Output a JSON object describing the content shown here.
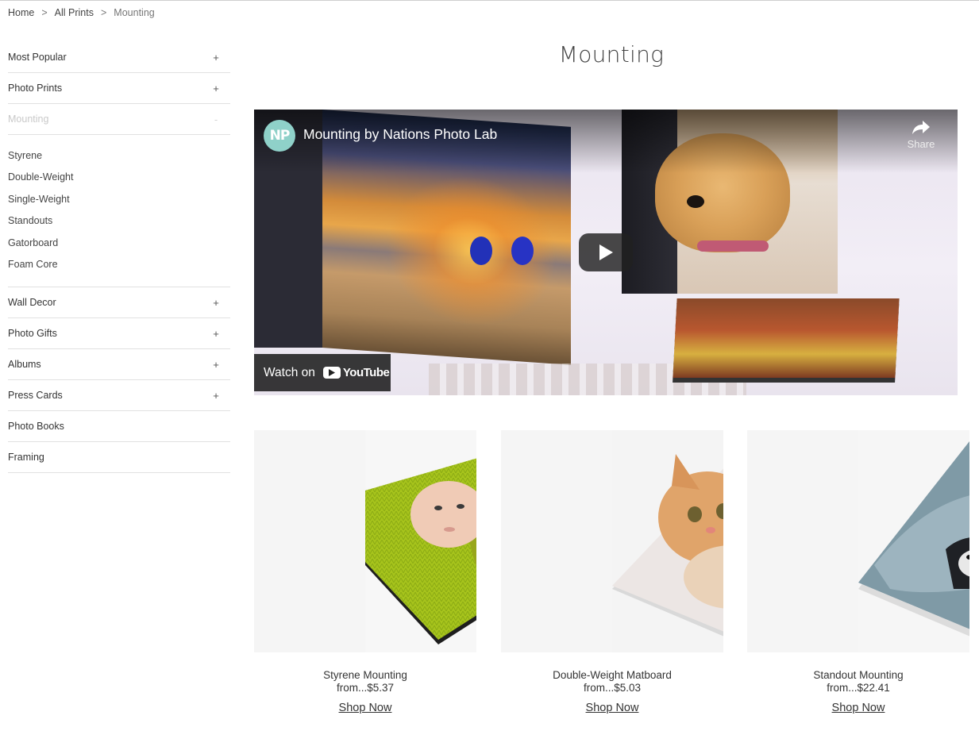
{
  "breadcrumb": {
    "items": [
      "Home",
      "All Prints",
      "Mounting"
    ],
    "separator": ">"
  },
  "sidebar": {
    "items_top": [
      {
        "label": "Most Popular",
        "toggle": "+"
      },
      {
        "label": "Photo Prints",
        "toggle": "+"
      }
    ],
    "active": {
      "label": "Mounting",
      "toggle": "-"
    },
    "subitems": [
      "Styrene",
      "Double-Weight",
      "Single-Weight",
      "Standouts",
      "Gatorboard",
      "Foam Core"
    ],
    "items_bottom": [
      {
        "label": "Wall Decor",
        "toggle": "+"
      },
      {
        "label": "Photo Gifts",
        "toggle": "+"
      },
      {
        "label": "Albums",
        "toggle": "+"
      },
      {
        "label": "Press Cards",
        "toggle": "+"
      },
      {
        "label": "Photo Books",
        "toggle": ""
      },
      {
        "label": "Framing",
        "toggle": ""
      }
    ]
  },
  "main": {
    "title": "Mounting",
    "video": {
      "channel_logo": "NP",
      "title": "Mounting by Nations Photo Lab",
      "share_label": "Share",
      "watch_on_label": "Watch on",
      "youtube_label": "YouTube"
    },
    "products": [
      {
        "name": "Styrene Mounting",
        "price": "from...$5.37",
        "cta": "Shop Now"
      },
      {
        "name": "Double-Weight Matboard",
        "price": "from...$5.03",
        "cta": "Shop Now"
      },
      {
        "name": "Standout Mounting",
        "price": "from...$22.41",
        "cta": "Shop Now"
      }
    ]
  }
}
